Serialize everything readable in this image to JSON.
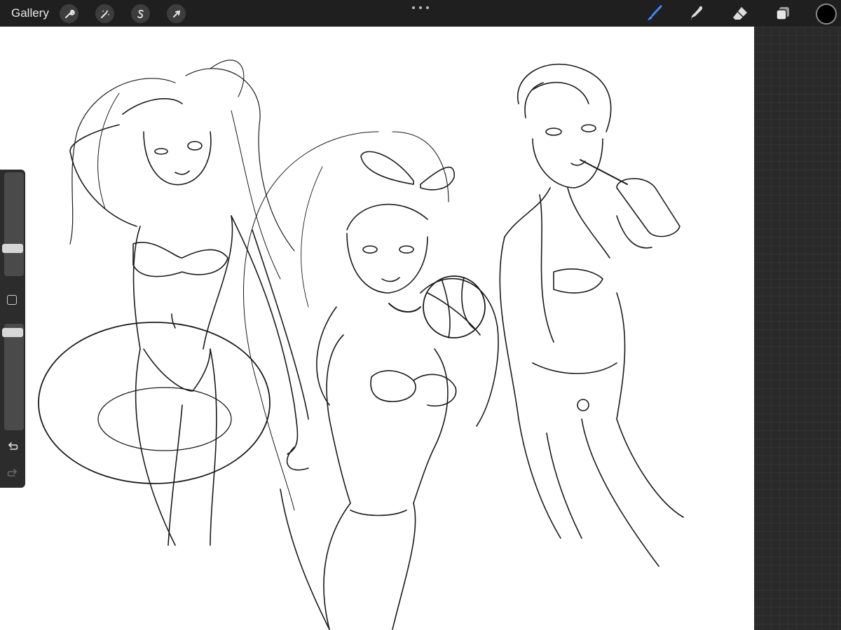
{
  "app": {
    "gallery_label": "Gallery"
  },
  "toolbar": {
    "left_tools": [
      {
        "name": "actions",
        "icon": "wrench-icon"
      },
      {
        "name": "adjustments",
        "icon": "magic-wand-icon"
      },
      {
        "name": "selection",
        "icon": "selection-s-icon"
      },
      {
        "name": "transform",
        "icon": "arrow-cursor-icon"
      }
    ],
    "right_tools": [
      {
        "name": "brush",
        "icon": "brush-icon",
        "active": true
      },
      {
        "name": "smudge",
        "icon": "smudge-icon"
      },
      {
        "name": "eraser",
        "icon": "eraser-icon"
      },
      {
        "name": "layers",
        "icon": "layers-icon"
      }
    ],
    "current_color": "#000000",
    "accent_color": "#3b8bff"
  },
  "sidebar": {
    "brush_size_level": 0.3,
    "opacity_level": 0.95
  }
}
